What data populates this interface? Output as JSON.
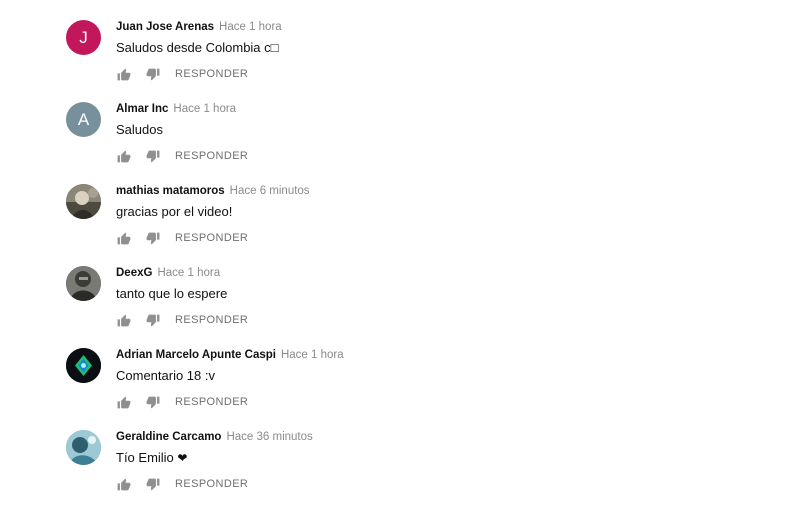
{
  "reply_label": "RESPONDER",
  "comments": [
    {
      "author": "Juan Jose Arenas",
      "time": "Hace 1 hora",
      "text": "Saludos desde Colombia c□",
      "avatar": {
        "initial": "J",
        "color": "#c2185b",
        "kind": "letter"
      }
    },
    {
      "author": "Almar Inc",
      "time": "Hace 1 hora",
      "text": "Saludos",
      "avatar": {
        "initial": "A",
        "color": "#78909c",
        "kind": "letter"
      }
    },
    {
      "author": "mathias matamoros",
      "time": "Hace 6 minutos",
      "text": "gracias por el video!",
      "avatar": {
        "initial": "",
        "color": "#6d6a5f",
        "kind": "photo"
      }
    },
    {
      "author": "DeexG",
      "time": "Hace 1 hora",
      "text": "tanto que lo espere",
      "avatar": {
        "initial": "",
        "color": "#5b5b58",
        "kind": "photo"
      }
    },
    {
      "author": "Adrian Marcelo Apunte Caspi",
      "time": "Hace 1 hora",
      "text": "Comentario 18 :v",
      "avatar": {
        "initial": "",
        "color": "#0b0f14",
        "kind": "logo"
      }
    },
    {
      "author": "Geraldine Carcamo",
      "time": "Hace 36 minutos",
      "text": "Tío Emilio",
      "text_suffix": "❤",
      "avatar": {
        "initial": "",
        "color": "#4a8fa3",
        "kind": "photo-light"
      }
    }
  ]
}
